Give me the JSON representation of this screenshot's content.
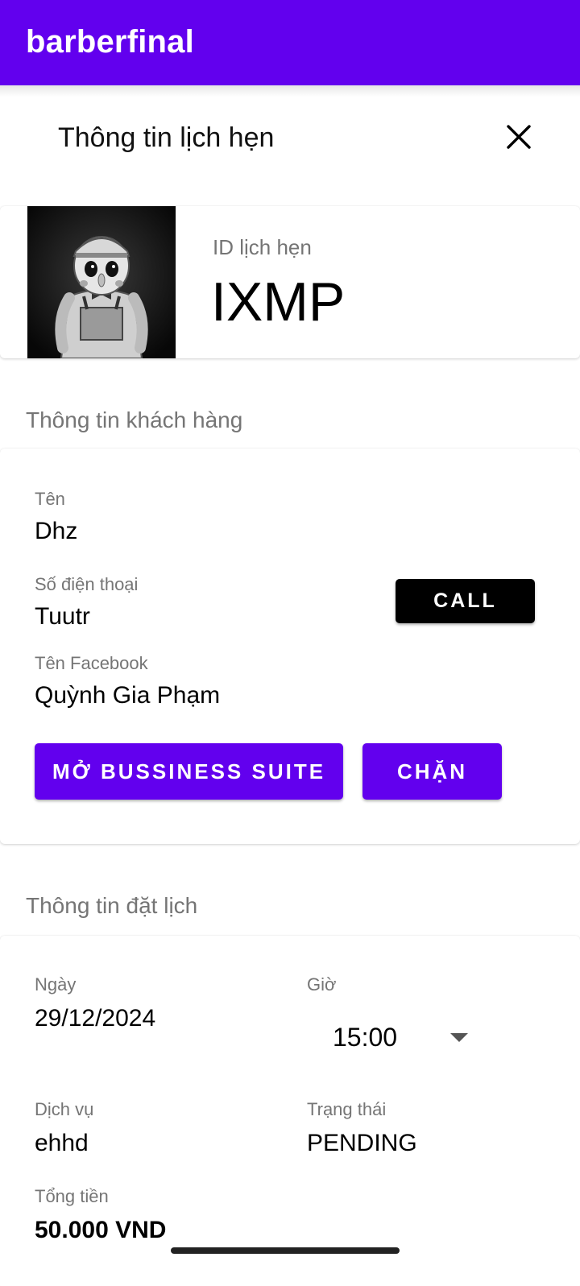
{
  "appbar": {
    "title": "barberfinal",
    "color": "#6200ee"
  },
  "dialog": {
    "title": "Thông tin lịch hẹn",
    "close_icon": "close-icon"
  },
  "appointment": {
    "id_label": "ID lịch hẹn",
    "id_value": "IXMP",
    "avatar_icon": "avatar-image"
  },
  "customer": {
    "section_title": "Thông tin khách hàng",
    "name_label": "Tên",
    "name_value": "Dhz",
    "phone_label": "Số điện thoại",
    "phone_value": "Tuutr",
    "call_label": "CALL",
    "facebook_label": "Tên Facebook",
    "facebook_value": "Quỳnh Gia Phạm",
    "suite_label": "MỞ BUSSINESS SUITE",
    "block_label": "CHẶN"
  },
  "booking": {
    "section_title": "Thông tin đặt lịch",
    "date_label": "Ngày",
    "date_value": "29/12/2024",
    "time_label": "Giờ",
    "time_value": "15:00",
    "service_label": "Dịch vụ",
    "service_value": "ehhd",
    "status_label": "Trạng thái",
    "status_value": "PENDING",
    "total_label": "Tổng tiền",
    "total_value": "50.000 VND"
  }
}
